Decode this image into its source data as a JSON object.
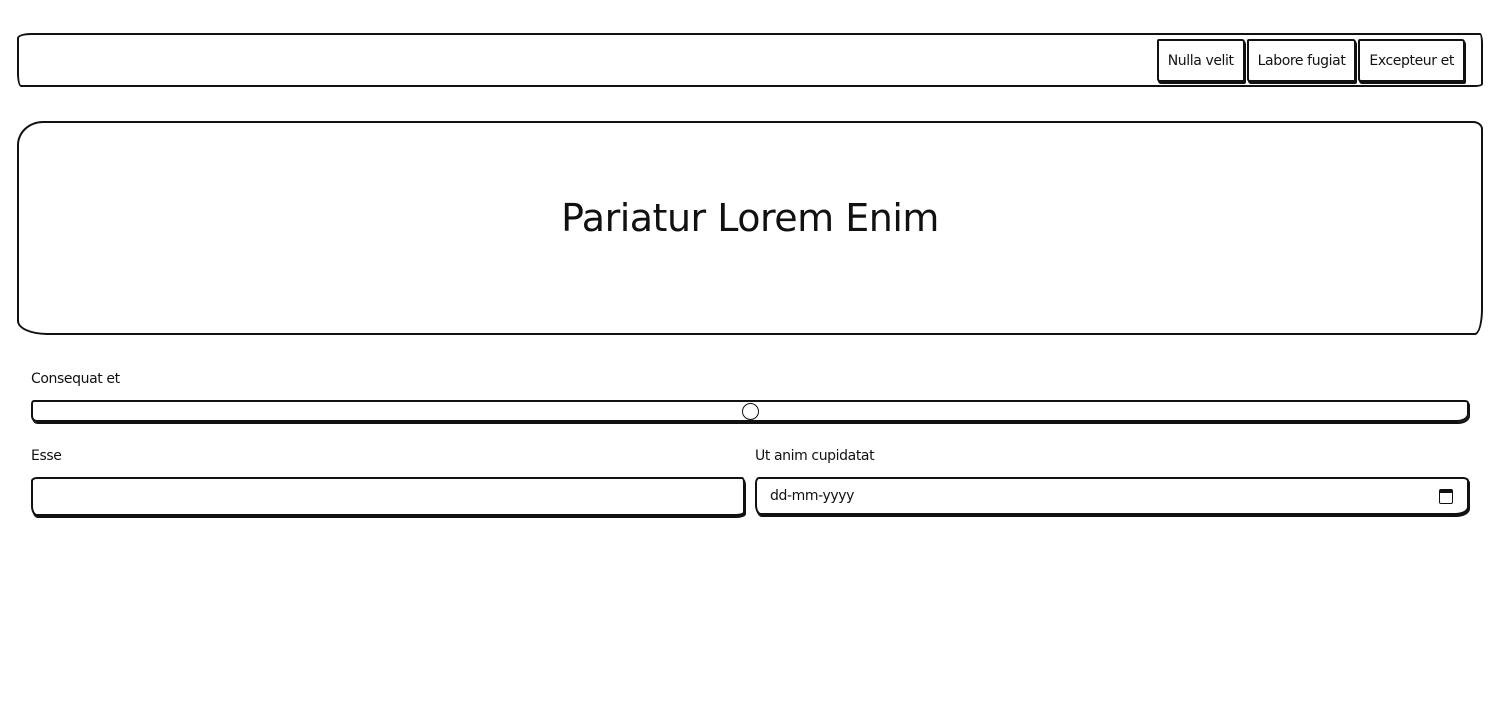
{
  "nav": {
    "buttons": [
      "Nulla velit",
      "Labore fugiat",
      "Excepteur et"
    ]
  },
  "hero": {
    "title": "Pariatur Lorem Enim"
  },
  "slider": {
    "label": "Consequat et",
    "value_fraction": 0.5
  },
  "form": {
    "text_field": {
      "label": "Esse",
      "value": ""
    },
    "date_field": {
      "label": "Ut anim cupidatat",
      "placeholder": "dd-mm-yyyy",
      "icon": "calendar-icon"
    }
  }
}
